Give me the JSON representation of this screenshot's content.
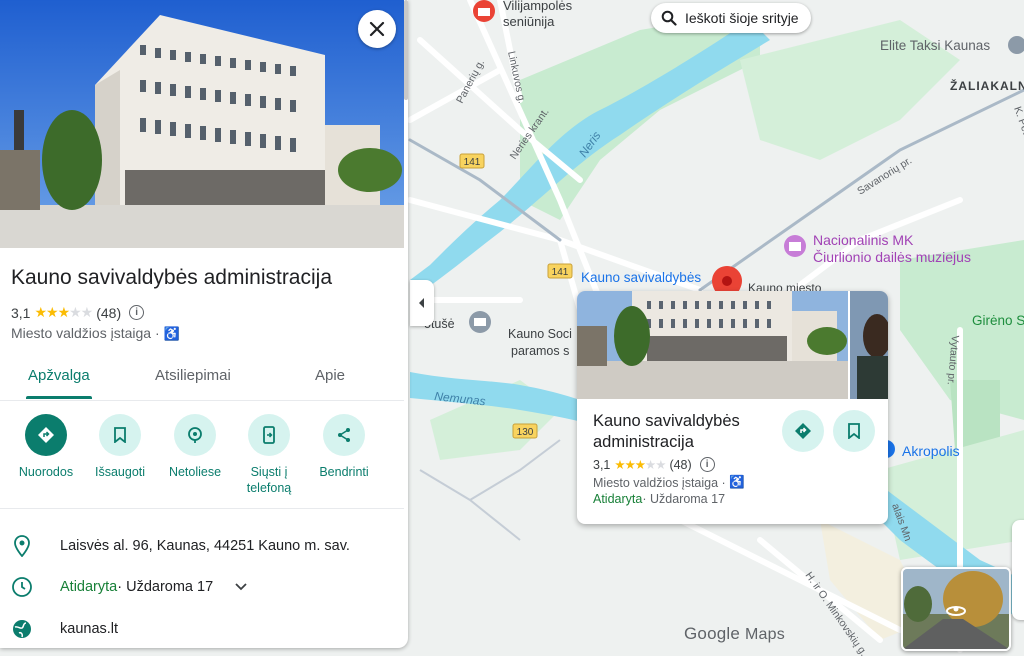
{
  "place": {
    "name": "Kauno savivaldybės administracija",
    "rating": "3,1",
    "reviews": "(48)",
    "category": "Miesto valdžios įstaiga",
    "category_sep": " · ",
    "address": "Laisvės al. 96, Kaunas, 44251 Kauno m. sav.",
    "open_status": "Atidaryta",
    "closes": " · Uždaroma 17",
    "website": "kaunas.lt"
  },
  "tabs": [
    "Apžvalga",
    "Atsiliepimai",
    "Apie"
  ],
  "actions": [
    {
      "label": "Nuorodos",
      "icon": "directions-icon"
    },
    {
      "label": "Išsaugoti",
      "icon": "bookmark-icon"
    },
    {
      "label": "Netoliese",
      "icon": "nearby-icon"
    },
    {
      "label": "Siųsti į telefoną",
      "icon": "send-to-phone-icon"
    },
    {
      "label": "Bendrinti",
      "icon": "share-icon"
    }
  ],
  "search_area": "Ieškoti šioje srityje",
  "card": {
    "name": "Kauno savivaldybės administracija",
    "rating": "3,1",
    "reviews": "(48)",
    "category": "Miesto valdžios įstaiga",
    "open_status": "Atidaryta",
    "closes": " · Uždaroma 17"
  },
  "map_labels": {
    "vilijampole1": "Vilijampolės",
    "vilijampole2": "seniūnija",
    "elite": "Elite Taksi Kaunas",
    "zaliakaln": "ŽALIAKALN",
    "paneriu": "Panerių g.",
    "linkuvos": "Linkuvos g.",
    "neries_krant": "Neries krant.",
    "neris": "Neris",
    "savanoriu": "Savanorių pr.",
    "r141a": "141",
    "r141b": "141",
    "r130": "130",
    "nacionalinis1": "Nacionalinis MK",
    "nacionalinis2": "Čiurlionio dailės muziejus",
    "kauno_sav": "Kauno savivaldybės",
    "kauno_miesto": "Kauno miesto",
    "kauno_soc1": "Kauno Soci",
    "kauno_soc2": "paramos s",
    "otuse": "otušė",
    "nemunas": "Nemunas",
    "akropolis": "Akropolis",
    "gireno": "Girėno S",
    "vytauto": "Vytauto pr.",
    "minkovskio": "H. ir O. Minkovskių g.",
    "k_petr": "K. Petr",
    "google": "Google",
    "maps": "Maps",
    "salis_mn": "alais Mn"
  },
  "colors": {
    "accent": "#0b7d6d",
    "accent_light": "#d6f3ef",
    "open": "#188038",
    "star": "#fbbc04",
    "water": "#90daee",
    "park": "#c8ebd0",
    "pin": "#ea4335"
  }
}
